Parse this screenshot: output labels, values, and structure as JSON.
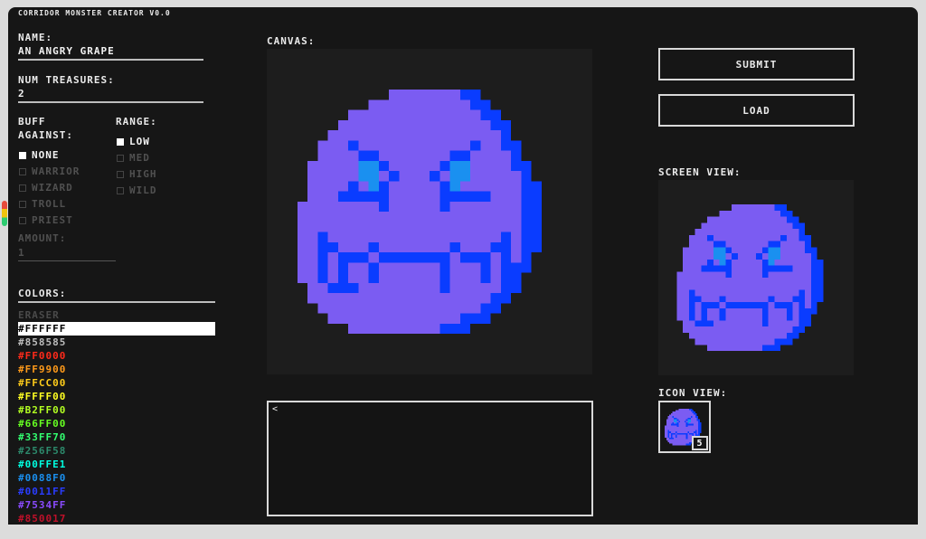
{
  "app": {
    "title": "CORRIDOR MONSTER CREATOR V0.0"
  },
  "name": {
    "label": "NAME:",
    "value": "AN ANGRY GRAPE"
  },
  "treasures": {
    "label": "NUM TREASURES:",
    "value": "2"
  },
  "buff": {
    "label_line1": "BUFF",
    "label_line2": "AGAINST:",
    "options": [
      {
        "label": "NONE",
        "selected": true
      },
      {
        "label": "WARRIOR",
        "selected": false
      },
      {
        "label": "WIZARD",
        "selected": false
      },
      {
        "label": "TROLL",
        "selected": false
      },
      {
        "label": "PRIEST",
        "selected": false
      }
    ],
    "amount_label": "AMOUNT:",
    "amount_value": "1"
  },
  "range": {
    "label": "RANGE:",
    "options": [
      {
        "label": "LOW",
        "selected": true
      },
      {
        "label": "MED",
        "selected": false
      },
      {
        "label": "HIGH",
        "selected": false
      },
      {
        "label": "WILD",
        "selected": false
      }
    ]
  },
  "colors": {
    "label": "COLORS:",
    "items": [
      {
        "label": "ERASER",
        "color": "#4a4a4a"
      },
      {
        "label": "#FFFFFF",
        "color": "#000000",
        "selected": true
      },
      {
        "label": "#858585",
        "color": "#bdbdbd"
      },
      {
        "label": "#FF0000",
        "color": "#ff2a1a"
      },
      {
        "label": "#FF9900",
        "color": "#ff9a1a"
      },
      {
        "label": "#FFCC00",
        "color": "#ffcc1a"
      },
      {
        "label": "#FFFF00",
        "color": "#ffff22"
      },
      {
        "label": "#B2FF00",
        "color": "#b2ff22"
      },
      {
        "label": "#66FF00",
        "color": "#66ff22"
      },
      {
        "label": "#33FF70",
        "color": "#33ff70"
      },
      {
        "label": "#256F58",
        "color": "#2d8a6c"
      },
      {
        "label": "#00FFE1",
        "color": "#00ffe1"
      },
      {
        "label": "#0088F0",
        "color": "#1a90f0"
      },
      {
        "label": "#0011FF",
        "color": "#2a3dff"
      },
      {
        "label": "#7534FF",
        "color": "#8a4bff"
      },
      {
        "label": "#850017",
        "color": "#c0102a"
      }
    ]
  },
  "canvas": {
    "label": "CANVAS:"
  },
  "buttons": {
    "submit": "SUBMIT",
    "load": "LOAD"
  },
  "screen_view": {
    "label": "SCREEN VIEW:"
  },
  "icon_view": {
    "label": "ICON VIEW:",
    "count": "5"
  },
  "textbox": {
    "value": "<"
  },
  "palette": {
    "purple": "#7b5cf2",
    "blue": "#0a3cff",
    "cyan": "#1a90f0",
    "bg": "#1d1d1d"
  }
}
